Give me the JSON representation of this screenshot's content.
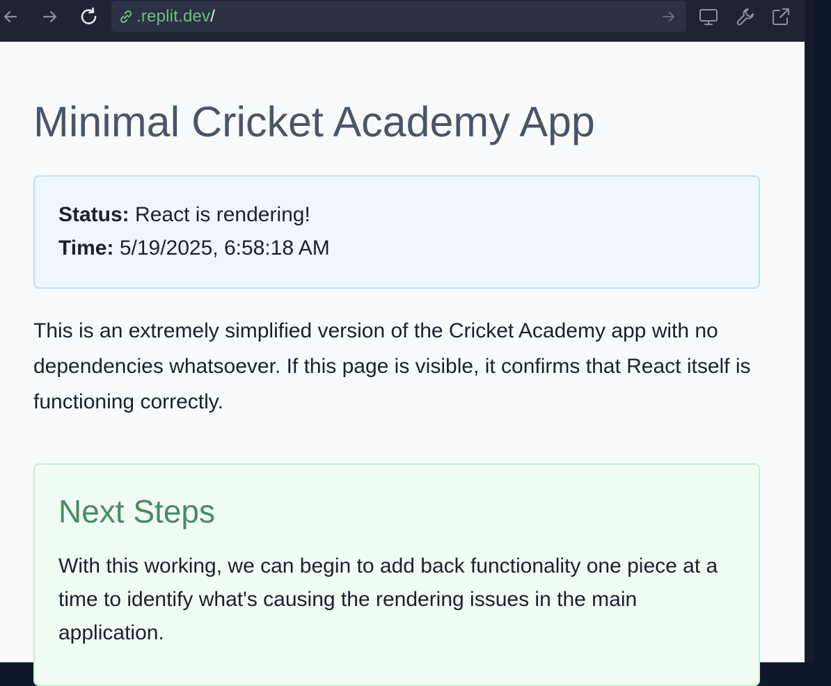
{
  "browser": {
    "url_domain": ".replit.dev",
    "url_slash": "/",
    "icons": [
      "back-arrow-icon",
      "forward-arrow-icon",
      "reload-icon",
      "link-icon",
      "go-arrow-icon",
      "monitor-icon",
      "wrench-icon",
      "external-link-icon"
    ]
  },
  "page": {
    "title": "Minimal Cricket Academy App",
    "status": {
      "status_label": "Status:",
      "status_value": "React is rendering!",
      "time_label": "Time:",
      "time_value": "5/19/2025, 6:58:18 AM"
    },
    "description": "This is an extremely simplified version of the Cricket Academy app with no dependencies whatsoever. If this page is visible, it confirms that React itself is functioning correctly.",
    "next_steps": {
      "heading": "Next Steps",
      "body": "With this working, we can begin to add back functionality one piece at a time to identify what's causing the rendering issues in the main application."
    }
  },
  "colors": {
    "toolbar_bg": "#1e2433",
    "url_green": "#6ebf7a",
    "status_bg": "#eef7ff",
    "next_bg": "#f0fdf4",
    "next_heading": "#4a8a62"
  }
}
